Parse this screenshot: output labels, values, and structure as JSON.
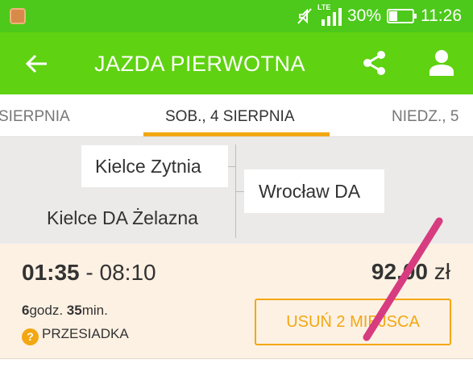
{
  "status_bar": {
    "network_label": "LTE",
    "battery_percent": "30%",
    "clock": "11:26",
    "icons": [
      "app-notification-icon",
      "mute-icon",
      "signal-icon",
      "battery-icon"
    ]
  },
  "app_bar": {
    "title": "JAZDA PIERWOTNA",
    "icons": [
      "back-arrow-icon",
      "share-icon",
      "profile-icon"
    ]
  },
  "tabs": {
    "prev_label": "SIERPNIA",
    "active_label": "SOB., 4 SIERPNIA",
    "next_label": "NIEDZ., 5"
  },
  "route": {
    "origin_primary": "Kielce Zytnia",
    "origin_secondary": "Kielce DA Żelazna",
    "destination": "Wrocław DA"
  },
  "connection": {
    "departure": "01:35",
    "separator": " - ",
    "arrival": "08:10",
    "price_amount": "92,00",
    "price_currency": " zł",
    "duration_hours": "6",
    "duration_hours_unit": "godz. ",
    "duration_minutes": "35",
    "duration_minutes_unit": "min.",
    "transfer_icon_glyph": "?",
    "transfer_label": "PRZESIADKA",
    "action_label": "USUŃ 2 MIEJSCA"
  },
  "colors": {
    "status_bar": "#4cc91b",
    "app_bar": "#5fd211",
    "accent": "#f3a712",
    "card_background": "#fdf1e3",
    "annotation_stroke": "#d63c7f"
  }
}
